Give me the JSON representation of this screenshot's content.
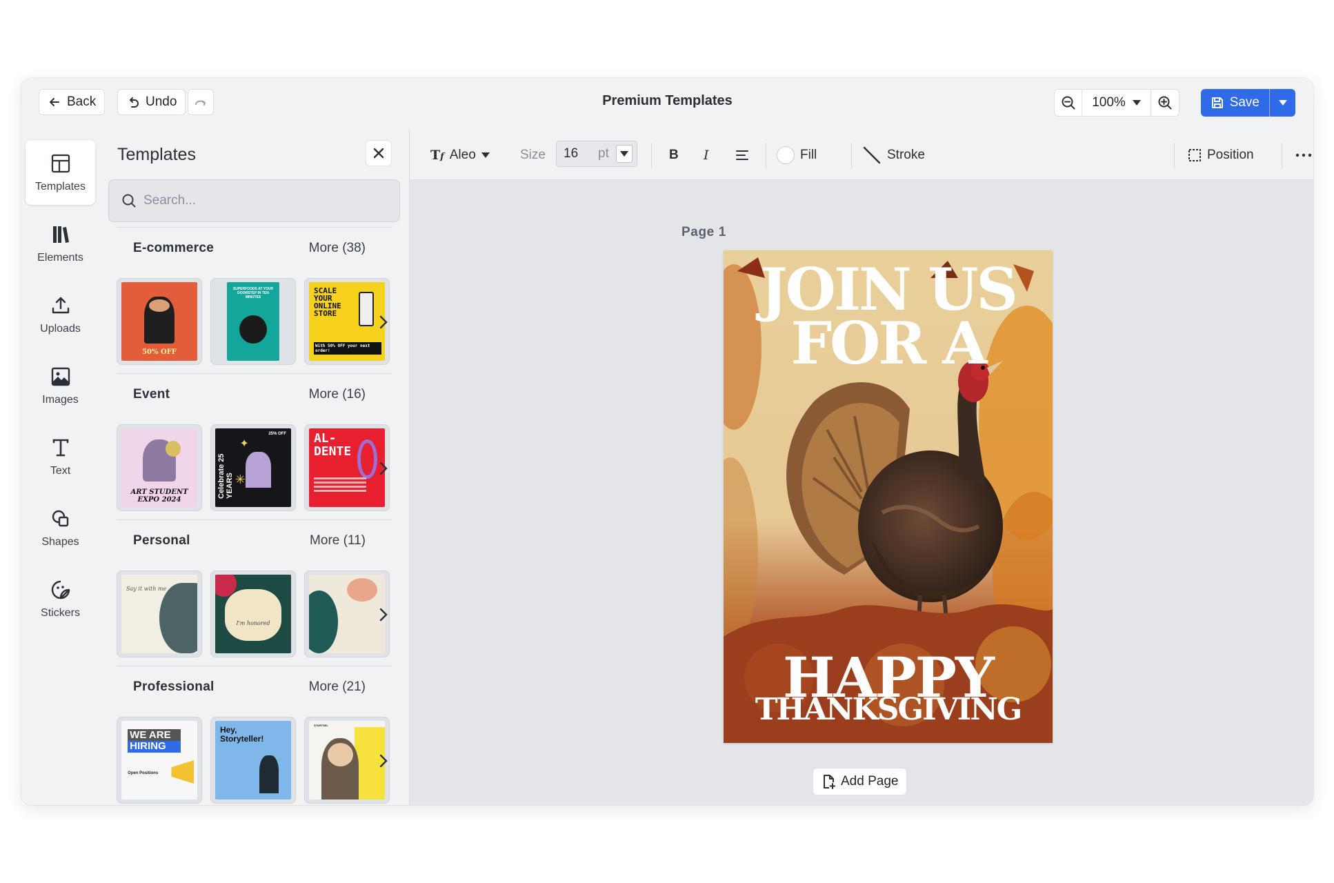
{
  "header": {
    "back_label": "Back",
    "undo_label": "Undo",
    "title": "Premium Templates",
    "zoom_level": "100%",
    "save_label": "Save"
  },
  "rail": {
    "items": [
      {
        "label": "Templates",
        "icon": "layout-icon",
        "active": true
      },
      {
        "label": "Elements",
        "icon": "elements-icon"
      },
      {
        "label": "Uploads",
        "icon": "upload-icon"
      },
      {
        "label": "Images",
        "icon": "image-icon"
      },
      {
        "label": "Text",
        "icon": "text-icon"
      },
      {
        "label": "Shapes",
        "icon": "shapes-icon"
      },
      {
        "label": "Stickers",
        "icon": "sticker-icon"
      }
    ]
  },
  "panel": {
    "title": "Templates",
    "search_placeholder": "Search...",
    "sections": [
      {
        "name": "E-commerce",
        "more": "More (38)",
        "thumbs": [
          {
            "text": "50% OFF"
          },
          {
            "text": "SUPERFOODS AT YOUR DOORSTEP IN TEN MINUTES"
          },
          {
            "text": "SCALE YOUR ONLINE STORE",
            "sub": "With 50% OFF your next order!"
          }
        ]
      },
      {
        "name": "Event",
        "more": "More (16)",
        "thumbs": [
          {
            "text": "ART STUDENT EXPO 2024"
          },
          {
            "text": "Celebrate 25 YEARS",
            "sub": "25% OFF"
          },
          {
            "text": "AL- DENTE"
          }
        ]
      },
      {
        "name": "Personal",
        "more": "More (11)",
        "thumbs": [
          {
            "text": "Say it with me"
          },
          {
            "text": "I'm honored"
          },
          {
            "text": ""
          }
        ]
      },
      {
        "name": "Professional",
        "more": "More (21)",
        "thumbs": [
          {
            "text": "WE ARE HIRING",
            "sub": "Open Positions"
          },
          {
            "text": "Hey, Storyteller!"
          },
          {
            "text": "STARTSEL"
          }
        ]
      }
    ]
  },
  "toolbar": {
    "font_name": "Aleo",
    "size_label": "Size",
    "size_value": "16",
    "size_unit": "pt",
    "bold": "B",
    "italic": "I",
    "fill_label": "Fill",
    "stroke_label": "Stroke",
    "position_label": "Position"
  },
  "canvas": {
    "page_label": "Page  1",
    "headline_line1": "JOIN US",
    "headline_line2": "FOR A",
    "footer_line1": "HAPPY",
    "footer_line2": "THANKSGIVING",
    "add_page_label": "Add Page"
  },
  "colors": {
    "accent": "#2f6be8",
    "app_bg": "#f1f2f4",
    "canvas_bg": "#e3e5e8"
  }
}
